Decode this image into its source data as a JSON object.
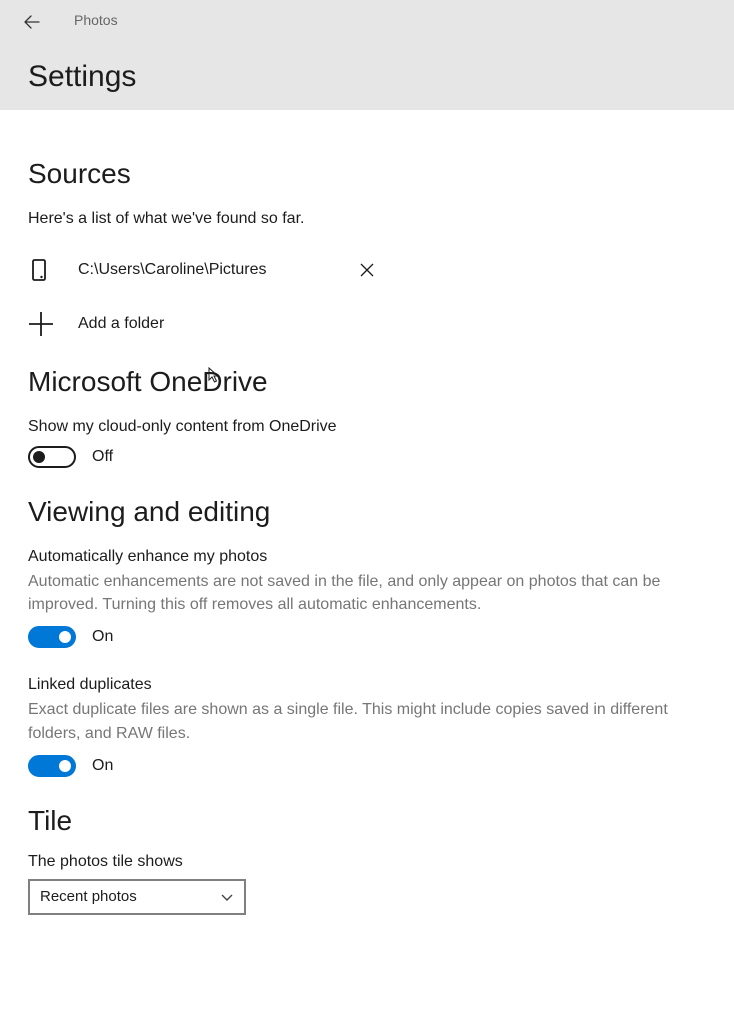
{
  "header": {
    "appTitle": "Photos",
    "pageTitle": "Settings"
  },
  "sources": {
    "heading": "Sources",
    "intro": "Here's a list of what we've found so far.",
    "folders": [
      {
        "path": "C:\\Users\\Caroline\\Pictures"
      }
    ],
    "addLabel": "Add a folder"
  },
  "onedrive": {
    "heading": "Microsoft OneDrive",
    "label": "Show my cloud-only content from OneDrive",
    "state": "Off"
  },
  "viewing": {
    "heading": "Viewing and editing",
    "enhance": {
      "label": "Automatically enhance my photos",
      "desc": "Automatic enhancements are not saved in the file, and only appear on photos that can be improved. Turning this off removes all automatic enhancements.",
      "state": "On"
    },
    "duplicates": {
      "label": "Linked duplicates",
      "desc": "Exact duplicate files are shown as a single file. This might include copies saved in different folders, and RAW files.",
      "state": "On"
    }
  },
  "tile": {
    "heading": "Tile",
    "label": "The photos tile shows",
    "selected": "Recent photos"
  }
}
